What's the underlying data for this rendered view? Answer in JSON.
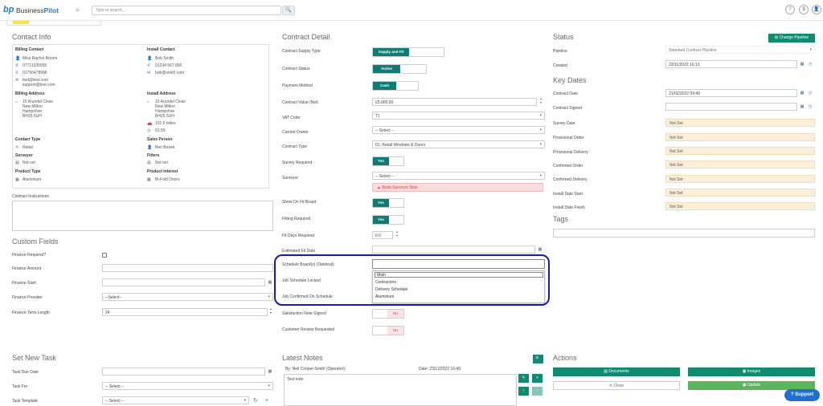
{
  "header": {
    "logo_mark": "bp",
    "logo_business": "Business",
    "logo_pilot": "Pilot",
    "menu_icon": "≡",
    "search_placeholder": "Type to search...",
    "search_icon": "🔍",
    "help_icon": "?",
    "dollar_icon": "$",
    "user_icon": "👤"
  },
  "contact_info": {
    "title": "Contact Info",
    "billing_contact": {
      "heading": "Billing Contact",
      "name": "Miss Rachel Broom",
      "phone1": "07711335555",
      "phone2": "01766478996",
      "email1": "test@test.com",
      "email2": "support@test.com"
    },
    "install_contact": {
      "heading": "Install Contact",
      "name": "Bob Smith",
      "phone": "01234 567 890",
      "email": "bob@smith.com"
    },
    "billing_address": {
      "heading": "Billing Address",
      "line1": "15 Arundel Close",
      "line2": "New Milton",
      "line3": "Hampshire",
      "line4": "BH25 5UH"
    },
    "install_address": {
      "heading": "Install Address",
      "line1": "15 Arundel Close",
      "line2": "New Milton",
      "line3": "Hampshire",
      "line4": "BH25 5UH",
      "distance": "101.0 miles",
      "time": "01:55"
    },
    "contact_type": {
      "heading": "Contact Type",
      "value": "Retail"
    },
    "sales_person": {
      "heading": "Sales Person",
      "value": "Ben Brown"
    },
    "surveyor": {
      "heading": "Surveyor",
      "value": "Not set"
    },
    "fitters": {
      "heading": "Fitters",
      "value": "Not set"
    },
    "product_type": {
      "heading": "Product Type",
      "value": "Aluminium"
    },
    "product_interest": {
      "heading": "Product Interest",
      "value": "Bi-Fold Doors"
    }
  },
  "contract_instructions": {
    "label": "Contract Instructions"
  },
  "custom_fields": {
    "title": "Custom Fields",
    "finance_required": "Finance Required?",
    "finance_amount": "Finance Amount",
    "finance_start": "Finance Start",
    "finance_provider": "Finance Provider",
    "finance_provider_value": "--Select--",
    "finance_term": "Finance Term Length",
    "finance_term_value": "24"
  },
  "contract_detail": {
    "title": "Contract Detail",
    "supply_type_label": "Contract Supply Type",
    "supply_type_value": "Supply and Fit",
    "status_label": "Contract Status",
    "status_value": "Active",
    "payment_label": "Payment Method",
    "payment_value": "Cash",
    "value_label": "Contract Value (Net)",
    "value_value": "£5,000.00",
    "vat_label": "VAT Code",
    "vat_value": "T1",
    "owner_label": "Current Owner",
    "owner_value": "-- Select --",
    "type_label": "Contract Type",
    "type_value": "01. Retail Windows & Doors",
    "survey_req_label": "Survey Required",
    "survey_req_value": "Yes",
    "surveyor_label": "Surveyor",
    "surveyor_value": "-- Select --",
    "book_surveyor": "Book Surveyor Now",
    "show_fit_label": "Show On Fit Board",
    "show_fit_value": "Yes",
    "fitting_label": "Fitting Required",
    "fitting_value": "Yes",
    "fit_days_label": "Fit Days Required",
    "fit_days_value": "0.0",
    "est_fit_label": "Estimated Fit Date",
    "schedule_boards_label": "Schedule Board(s) (Optional)",
    "schedule_locked_label": "Job Schedule Locked",
    "job_confirmed_label": "Job Confirmed On Schedule",
    "satisfaction_label": "Satisfaction Note Signed",
    "satisfaction_value": "No",
    "review_label": "Customer Review Requested",
    "review_value": "No",
    "dropdown_options": [
      "Main",
      "Contractors",
      "Delivery Schedule",
      "Aluminium"
    ]
  },
  "status": {
    "title": "Status",
    "change_pipeline": "Change Pipeline",
    "pipeline_label": "Pipeline",
    "pipeline_value": "Standard Contract Pipeline",
    "created_label": "Created",
    "created_value": "23/11/2022 16:13"
  },
  "key_dates": {
    "title": "Key Dates",
    "contract_date_label": "Contract Date",
    "contract_date_value": "21/02/2022 09:49",
    "contract_signed_label": "Contract Signed",
    "survey_date": "Survey Date",
    "provisional_order": "Provisional Order",
    "provisional_delivery": "Provisional Delivery",
    "confirmed_order": "Confirmed Order",
    "confirmed_delivery": "Confirmed Delivery",
    "install_start": "Install Date Start",
    "install_finish": "Install Date Finish",
    "not_set": "Not Set"
  },
  "tags": {
    "title": "Tags"
  },
  "set_new_task": {
    "title": "Set New Task",
    "due_date": "Task Due Date",
    "task_for": "Task For",
    "task_for_value": "-- Select --",
    "template": "Task Template",
    "template_value": "-- Select --"
  },
  "latest_notes": {
    "title": "Latest Notes",
    "by": "By: Neil Cooper-Smith (Operator)",
    "date": "Date: 23/11/2022 16:49",
    "note": "Test note"
  },
  "actions": {
    "title": "Actions",
    "documents": "Documents",
    "images": "Images",
    "close": "Close",
    "update": "Update"
  },
  "support": "Support"
}
